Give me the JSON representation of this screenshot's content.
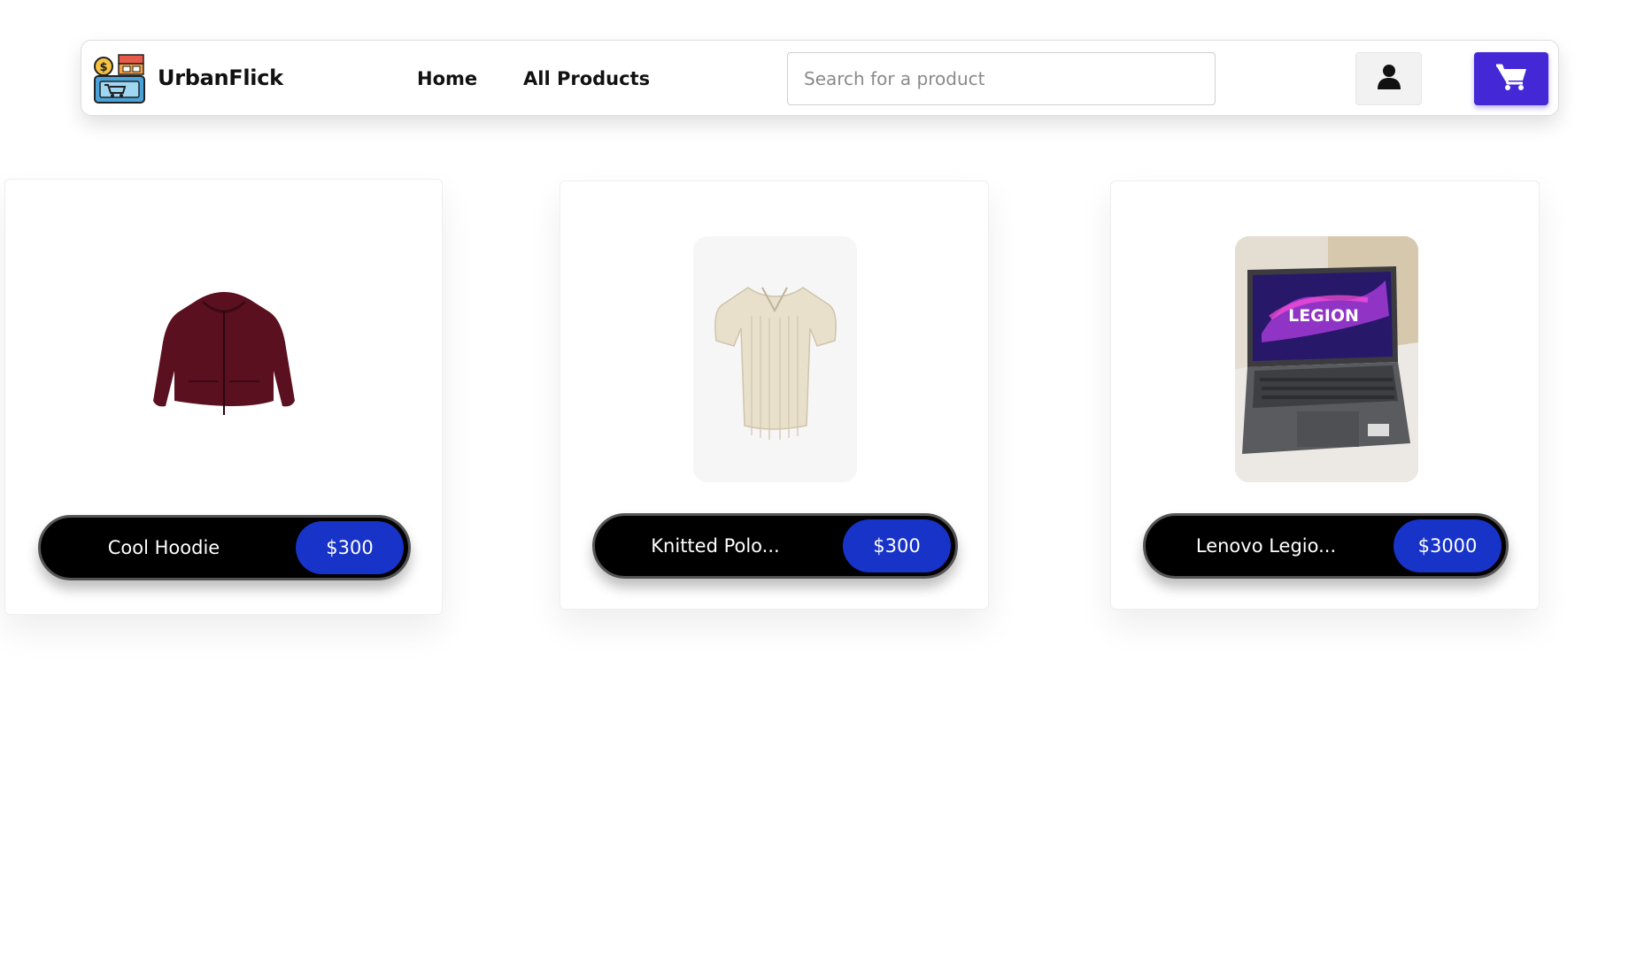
{
  "header": {
    "brand": "UrbanFlick",
    "logo_icon": "store-icon",
    "nav": [
      {
        "label": "Home"
      },
      {
        "label": "All Products"
      }
    ],
    "search": {
      "placeholder": "Search for a product",
      "value": ""
    },
    "user_icon": "user-icon",
    "cart_icon": "cart-icon",
    "accent_color": "#4428d6"
  },
  "products": [
    {
      "name": "Cool Hoodie",
      "price": "$300",
      "image_icon": "hoodie-image"
    },
    {
      "name": "Knitted Polo...",
      "price": "$300",
      "image_icon": "polo-shirt-image"
    },
    {
      "name": "Lenovo Legio...",
      "price": "$3000",
      "image_icon": "laptop-image",
      "image_caption": "LEGION"
    }
  ],
  "colors": {
    "pill_bg": "#000000",
    "price_badge": "#1733c8"
  }
}
